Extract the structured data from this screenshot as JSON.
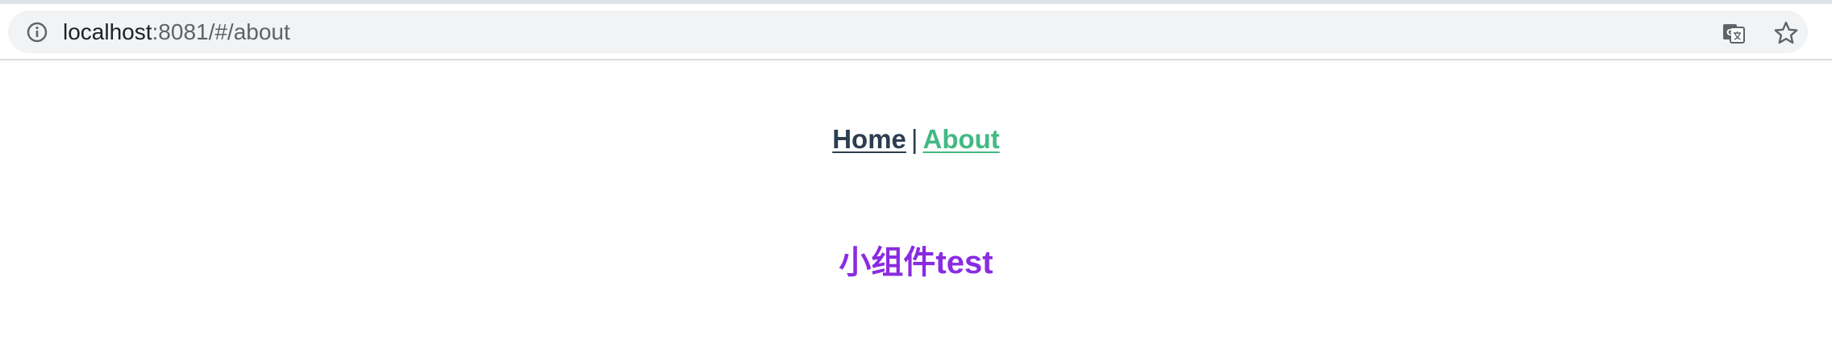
{
  "browser": {
    "url_host": "localhost",
    "url_rest": ":8081/#/about",
    "icons": {
      "info": "info-icon",
      "translate": "translate-icon",
      "star": "star-icon"
    }
  },
  "nav": {
    "home_label": "Home",
    "separator": "|",
    "about_label": "About"
  },
  "content": {
    "heading": "小组件test"
  },
  "colors": {
    "nav_text": "#2c3e50",
    "active_link": "#42b983",
    "heading": "#8a2be2"
  }
}
